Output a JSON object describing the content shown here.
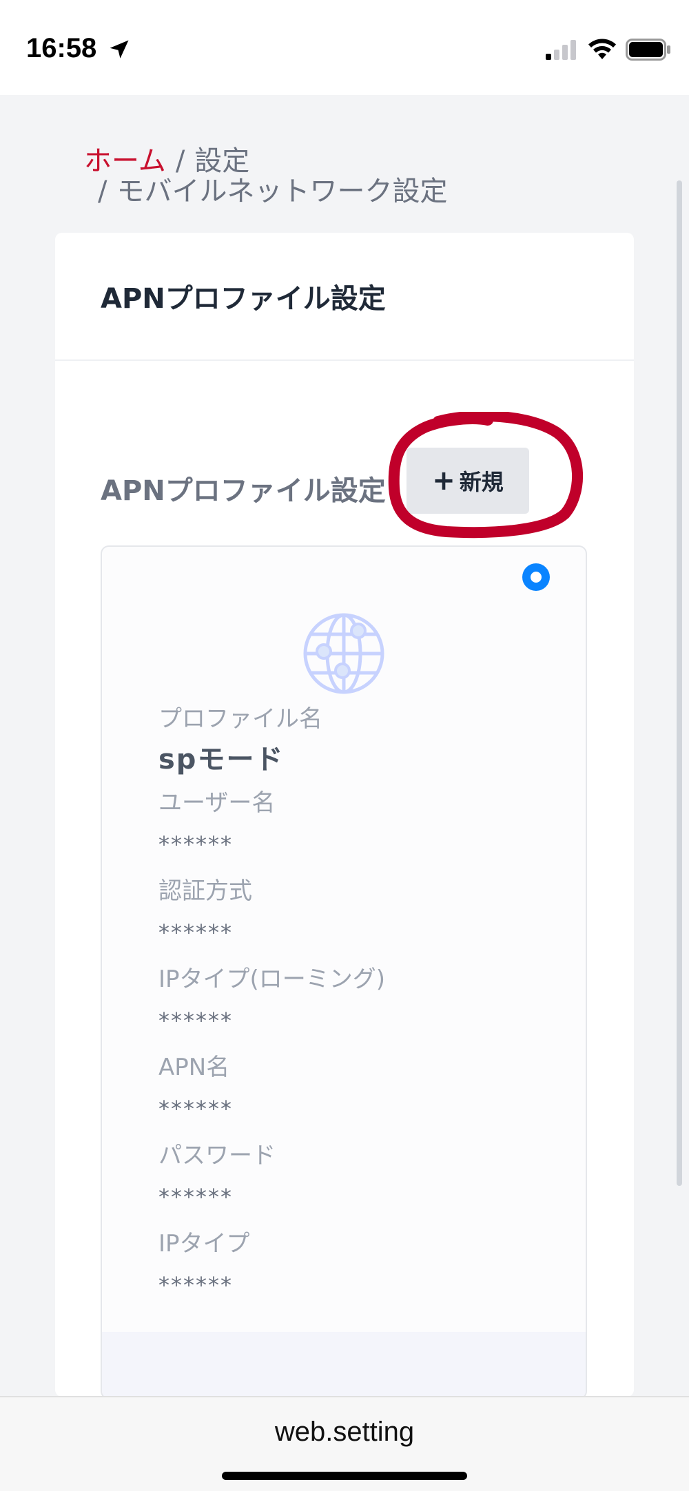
{
  "status_bar": {
    "time": "16:58",
    "icons": [
      "location-arrow-icon",
      "cellular-signal-icon",
      "wifi-icon",
      "battery-icon"
    ]
  },
  "breadcrumb": {
    "home": "ホーム",
    "separator": "/",
    "settings": "設定",
    "mobile_network": "モバイルネットワーク設定"
  },
  "card": {
    "title": "APNプロファイル設定",
    "section_title": "APNプロファイル設定",
    "new_button_label": "新規"
  },
  "profile": {
    "selected": true,
    "icon": "globe-network-icon",
    "fields": [
      {
        "label": "プロファイル名",
        "value": "spモード"
      },
      {
        "label": "ユーザー名",
        "value": "******"
      },
      {
        "label": "認証方式",
        "value": "******"
      },
      {
        "label": "IPタイプ(ローミング)",
        "value": "******"
      },
      {
        "label": "APN名",
        "value": "******"
      },
      {
        "label": "パスワード",
        "value": "******"
      },
      {
        "label": "IPタイプ",
        "value": "******"
      }
    ]
  },
  "browser": {
    "url": "web.setting"
  },
  "colors": {
    "accent_red": "#c8102e",
    "radio_blue": "#0a84ff",
    "annotation_red": "#c0002a"
  }
}
